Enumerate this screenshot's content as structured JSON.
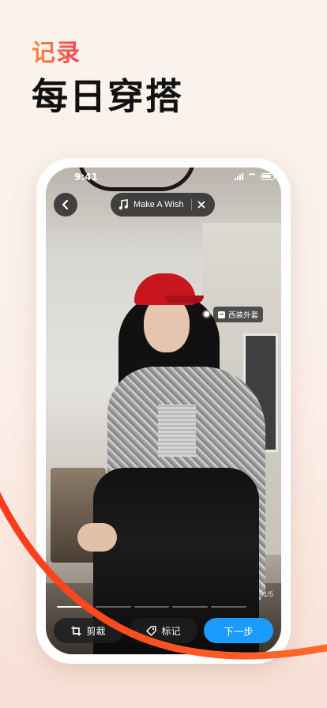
{
  "headline": {
    "accent": "记录",
    "main": "每日穿搭"
  },
  "status_bar": {
    "time": "9:41",
    "icons": [
      "signal-icon",
      "wifi-icon",
      "battery-icon"
    ]
  },
  "toolbar": {
    "back_icon": "chevron-left-icon",
    "music": {
      "icon": "music-note-icon",
      "title": "Make A Wish",
      "close_icon": "close-icon"
    }
  },
  "photo": {
    "tag": {
      "icon": "tag-icon",
      "label": "西装外套"
    },
    "page_indicator": "1/5",
    "progress": {
      "current": 1,
      "total": 5
    }
  },
  "bottom_actions": {
    "crop_label": "剪裁",
    "crop_icon": "crop-icon",
    "tag_label": "标记",
    "tag_icon": "tag-icon",
    "next_label": "下一步"
  },
  "colors": {
    "accent_gradient": [
      "#ff8a3d",
      "#ff3f5a"
    ],
    "primary_button": "#1a9bff",
    "swoosh": "#ff4a1c"
  }
}
